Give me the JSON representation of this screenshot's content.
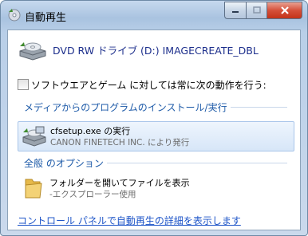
{
  "window": {
    "title": "自動再生",
    "icons": {
      "title": "autoplay-cd-icon",
      "minimize": "minimize-icon",
      "maximize": "maximize-icon",
      "close": "close-icon"
    }
  },
  "drive": {
    "title": "DVD RW ドライブ (D:) IMAGECREATE_DBL",
    "icon": "dvd-drive-icon"
  },
  "always_checkbox": {
    "label": "ソフトウエアとゲーム に対しては常に次の動作を行う:",
    "checked": false
  },
  "media_section": {
    "header": "メディアからのプログラムのインストール/実行",
    "options": [
      {
        "title": "cfsetup.exe の実行",
        "subtitle": "CANON FINETECH INC. により発行",
        "icon": "installer-drive-icon",
        "selected": true
      }
    ]
  },
  "general_section": {
    "header": "全般 のオプション",
    "options": [
      {
        "title": "フォルダーを開いてファイルを表示",
        "subtitle": "-エクスプローラー使用",
        "icon": "folder-icon",
        "selected": false
      }
    ]
  },
  "footer_link": "コントロール パネルで自動再生の詳細を表示します",
  "colors": {
    "accent": "#1d5aa8",
    "link": "#1e55c8",
    "drive_title": "#1d2f8c",
    "close": "#d5503a"
  }
}
